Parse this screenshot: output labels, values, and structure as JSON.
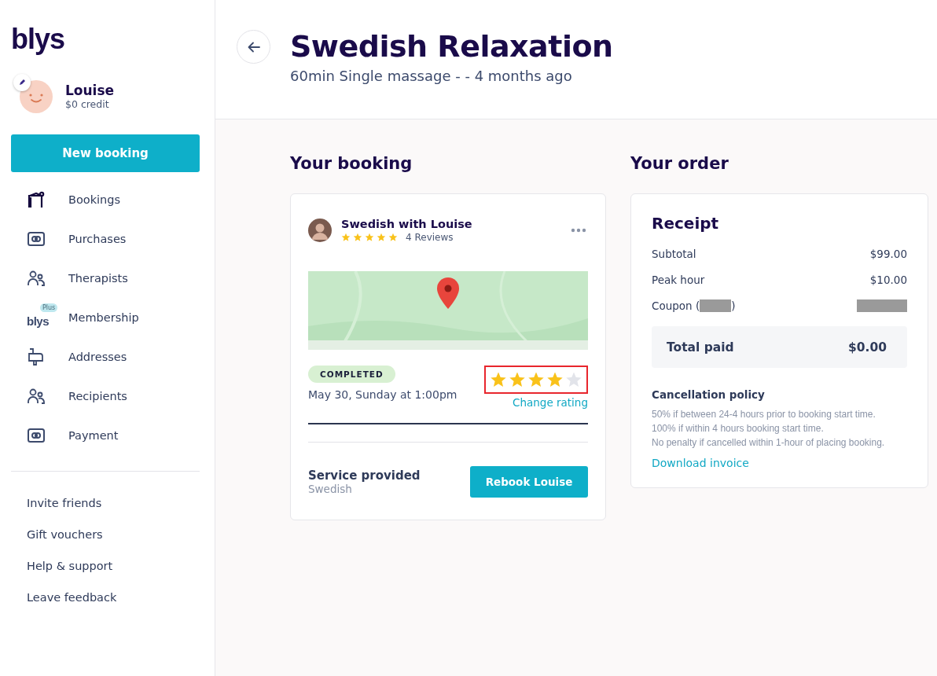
{
  "sidebar": {
    "logo": "blys",
    "user": {
      "name": "Louise",
      "credit": "$0 credit"
    },
    "new_booking": "New booking",
    "nav": [
      {
        "kind": "icon",
        "label": "Bookings"
      },
      {
        "kind": "icon",
        "label": "Purchases"
      },
      {
        "kind": "icon",
        "label": "Therapists"
      },
      {
        "kind": "logo",
        "label": "Membership",
        "icon_text": "blys",
        "badge": "Plus"
      },
      {
        "kind": "icon",
        "label": "Addresses"
      },
      {
        "kind": "icon",
        "label": "Recipients"
      },
      {
        "kind": "icon",
        "label": "Payment"
      }
    ],
    "links": [
      "Invite friends",
      "Gift vouchers",
      "Help & support",
      "Leave feedback"
    ]
  },
  "header": {
    "title": "Swedish Relaxation",
    "subtitle": "60min Single massage - - 4 months ago"
  },
  "booking": {
    "heading": "Your booking",
    "therapist": {
      "name": "Swedish with Louise",
      "stars": 5,
      "reviews": "4 Reviews"
    },
    "status": "COMPLETED",
    "rating": {
      "stars": 4,
      "highlighted": true
    },
    "datetime": "May 30, Sunday at 1:00pm",
    "change_rating": "Change rating",
    "service_label": "Service provided",
    "service": "Swedish",
    "rebook": "Rebook Louise"
  },
  "order": {
    "heading": "Your order",
    "receipt": {
      "title": "Receipt",
      "rows": [
        {
          "kind": "plain",
          "label": "Subtotal",
          "value": "$99.00"
        },
        {
          "kind": "plain",
          "label": "Peak hour",
          "value": "$10.00"
        },
        {
          "kind": "redacted",
          "label": "Coupon (",
          "label_end": ")"
        }
      ],
      "total": {
        "label": "Total paid",
        "value": "$0.00"
      }
    },
    "policy": {
      "title": "Cancellation policy",
      "lines": [
        "50% if between 24-4 hours prior to booking start time.",
        "100% if within 4 hours booking start time.",
        "No penalty if cancelled within 1-hour of placing booking."
      ]
    },
    "download": "Download invoice"
  }
}
